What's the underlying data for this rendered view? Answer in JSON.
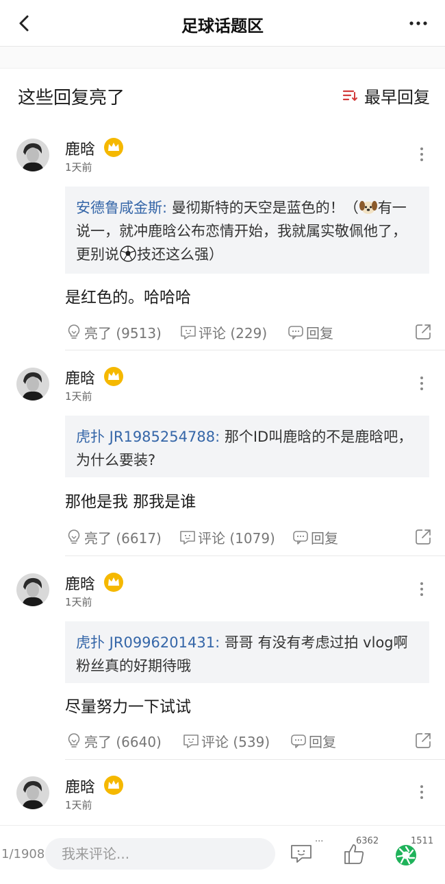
{
  "header": {
    "title": "足球话题区"
  },
  "section": {
    "title": "这些回复亮了",
    "sort_label": "最早回复"
  },
  "posts": [
    {
      "user": "鹿晗",
      "time": "1天前",
      "quote_author": "安德鲁咸金斯:",
      "quote_text_1": " 曼彻斯特的天空是蓝色的！（",
      "quote_text_2": "有一说一，就冲鹿晗公布恋情开始，我就属实敬佩他了，更别说",
      "quote_text_3": "技还这么强）",
      "reply": "是红色的。哈哈哈",
      "light": "亮了 (9513)",
      "comment": "评论 (229)",
      "reply_label": "回复"
    },
    {
      "user": "鹿晗",
      "time": "1天前",
      "quote_author": "虎扑 JR1985254788:",
      "quote_text": " 那个ID叫鹿晗的不是鹿晗吧，为什么要装?",
      "reply": "那他是我 那我是谁",
      "light": "亮了 (6617)",
      "comment": "评论 (1079)",
      "reply_label": "回复"
    },
    {
      "user": "鹿晗",
      "time": "1天前",
      "quote_author": "虎扑 JR0996201431:",
      "quote_text": " 哥哥 有没有考虑过拍 vlog啊 粉丝真的好期待哦",
      "reply": "尽量努力一下试试",
      "light": "亮了 (6640)",
      "comment": "评论 (539)",
      "reply_label": "回复"
    },
    {
      "user": "鹿晗",
      "time": "1天前"
    }
  ],
  "bottom": {
    "page_counter": "1/1908",
    "input_placeholder": "我来评论...",
    "like_count": "6362",
    "share_count": "1511",
    "comment_badge": "..."
  },
  "colors": {
    "link_blue": "#3566a8",
    "crown_gold": "#f5b800",
    "sort_red": "#d23a3a",
    "share_green": "#1fb25a"
  },
  "icons": {
    "back": "chevron-left-icon",
    "more": "ellipsis-icon",
    "sort": "sort-lines-icon",
    "crown": "crown-badge-icon",
    "light": "lightbulb-icon",
    "comment": "comment-bubble-icon",
    "reply": "reply-bubble-icon",
    "share": "share-arrow-icon",
    "like": "thumbs-up-icon",
    "shutter": "shutter-icon",
    "dog": "dog-face-emoji",
    "soccer": "soccer-ball-emoji"
  }
}
